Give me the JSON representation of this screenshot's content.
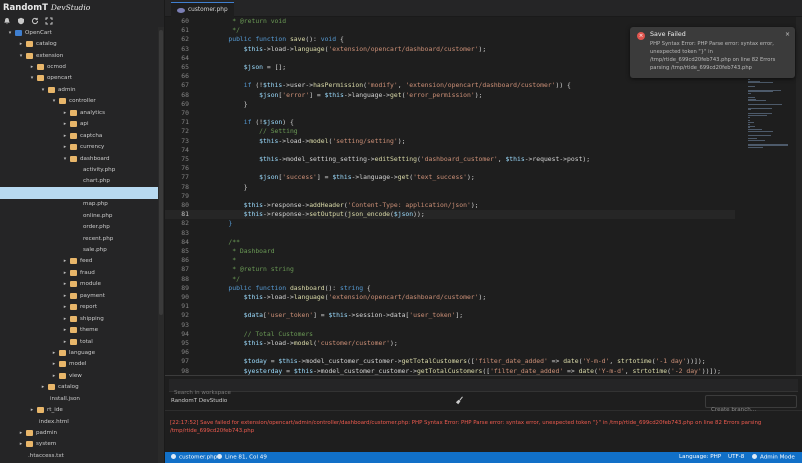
{
  "app": {
    "brand_main": "RandomT",
    "brand_sub": "DevStudio",
    "toolbar_icons": [
      "bell-icon",
      "shield-icon",
      "refresh-icon",
      "expand-icon"
    ]
  },
  "tree": [
    {
      "label": "OpenCart",
      "depth": 0,
      "kind": "root-open",
      "selected": false
    },
    {
      "label": "catalog",
      "depth": 1,
      "kind": "dir-closed",
      "selected": false
    },
    {
      "label": "extension",
      "depth": 1,
      "kind": "dir-open",
      "selected": false
    },
    {
      "label": "ocmod",
      "depth": 2,
      "kind": "dir-closed",
      "selected": false
    },
    {
      "label": "opencart",
      "depth": 2,
      "kind": "dir-open",
      "selected": false
    },
    {
      "label": "admin",
      "depth": 3,
      "kind": "dir-open",
      "selected": false
    },
    {
      "label": "controller",
      "depth": 4,
      "kind": "dir-open",
      "selected": false
    },
    {
      "label": "analytics",
      "depth": 5,
      "kind": "dir-closed",
      "selected": false
    },
    {
      "label": "api",
      "depth": 5,
      "kind": "dir-closed",
      "selected": false
    },
    {
      "label": "captcha",
      "depth": 5,
      "kind": "dir-closed",
      "selected": false
    },
    {
      "label": "currency",
      "depth": 5,
      "kind": "dir-closed",
      "selected": false
    },
    {
      "label": "dashboard",
      "depth": 5,
      "kind": "dir-open",
      "selected": false
    },
    {
      "label": "activity.php",
      "depth": 6,
      "kind": "file",
      "selected": false
    },
    {
      "label": "chart.php",
      "depth": 6,
      "kind": "file",
      "selected": false
    },
    {
      "label": "",
      "depth": 6,
      "kind": "file",
      "selected": true
    },
    {
      "label": "map.php",
      "depth": 6,
      "kind": "file",
      "selected": false
    },
    {
      "label": "online.php",
      "depth": 6,
      "kind": "file",
      "selected": false
    },
    {
      "label": "order.php",
      "depth": 6,
      "kind": "file",
      "selected": false
    },
    {
      "label": "recent.php",
      "depth": 6,
      "kind": "file",
      "selected": false
    },
    {
      "label": "sale.php",
      "depth": 6,
      "kind": "file",
      "selected": false
    },
    {
      "label": "feed",
      "depth": 5,
      "kind": "dir-closed",
      "selected": false
    },
    {
      "label": "fraud",
      "depth": 5,
      "kind": "dir-closed",
      "selected": false
    },
    {
      "label": "module",
      "depth": 5,
      "kind": "dir-closed",
      "selected": false
    },
    {
      "label": "payment",
      "depth": 5,
      "kind": "dir-closed",
      "selected": false
    },
    {
      "label": "report",
      "depth": 5,
      "kind": "dir-closed",
      "selected": false
    },
    {
      "label": "shipping",
      "depth": 5,
      "kind": "dir-closed",
      "selected": false
    },
    {
      "label": "theme",
      "depth": 5,
      "kind": "dir-closed",
      "selected": false
    },
    {
      "label": "total",
      "depth": 5,
      "kind": "dir-closed",
      "selected": false
    },
    {
      "label": "language",
      "depth": 4,
      "kind": "dir-closed",
      "selected": false
    },
    {
      "label": "model",
      "depth": 4,
      "kind": "dir-closed",
      "selected": false
    },
    {
      "label": "view",
      "depth": 4,
      "kind": "dir-closed",
      "selected": false
    },
    {
      "label": "catalog",
      "depth": 3,
      "kind": "dir-closed",
      "selected": false
    },
    {
      "label": "install.json",
      "depth": 3,
      "kind": "file",
      "selected": false
    },
    {
      "label": "rt_ide",
      "depth": 2,
      "kind": "dir-closed",
      "selected": false
    },
    {
      "label": "index.html",
      "depth": 2,
      "kind": "file",
      "selected": false
    },
    {
      "label": "padmin",
      "depth": 1,
      "kind": "dir-closed",
      "selected": false
    },
    {
      "label": "system",
      "depth": 1,
      "kind": "dir-closed",
      "selected": false
    },
    {
      "label": ".htaccess.txt",
      "depth": 1,
      "kind": "file",
      "selected": false
    }
  ],
  "editor": {
    "tab_label": "customer.php",
    "current_line": 81,
    "lines": [
      {
        "n": 60,
        "t": [
          [
            "c",
            "     * @return void"
          ]
        ]
      },
      {
        "n": 61,
        "t": [
          [
            "c",
            "     */"
          ]
        ]
      },
      {
        "n": 62,
        "t": [
          [
            "k",
            "    public function "
          ],
          [
            "f",
            "save"
          ],
          [
            "p",
            "(): "
          ],
          [
            "k",
            "void"
          ],
          [
            "p",
            " {"
          ]
        ]
      },
      {
        "n": 63,
        "t": [
          [
            "v",
            "        $this"
          ],
          [
            "p",
            "->load->"
          ],
          [
            "f",
            "language"
          ],
          [
            "p",
            "("
          ],
          [
            "s",
            "'extension/opencart/dashboard/customer'"
          ],
          [
            "p",
            ");"
          ]
        ]
      },
      {
        "n": 64,
        "t": []
      },
      {
        "n": 65,
        "t": [
          [
            "v",
            "        $json"
          ],
          [
            "p",
            " = [];"
          ]
        ]
      },
      {
        "n": 66,
        "t": []
      },
      {
        "n": 67,
        "t": [
          [
            "k",
            "        if"
          ],
          [
            "p",
            " (!"
          ],
          [
            "v",
            "$this"
          ],
          [
            "p",
            "->user->"
          ],
          [
            "f",
            "hasPermission"
          ],
          [
            "p",
            "("
          ],
          [
            "s",
            "'modify'"
          ],
          [
            "p",
            ", "
          ],
          [
            "s",
            "'extension/opencart/dashboard/customer'"
          ],
          [
            "p",
            ")) {"
          ]
        ]
      },
      {
        "n": 68,
        "t": [
          [
            "v",
            "            $json"
          ],
          [
            "p",
            "["
          ],
          [
            "s",
            "'error'"
          ],
          [
            "p",
            "] = "
          ],
          [
            "v",
            "$this"
          ],
          [
            "p",
            "->language->"
          ],
          [
            "f",
            "get"
          ],
          [
            "p",
            "("
          ],
          [
            "s",
            "'error_permission'"
          ],
          [
            "p",
            ");"
          ]
        ]
      },
      {
        "n": 69,
        "t": [
          [
            "p",
            "        }"
          ]
        ]
      },
      {
        "n": 70,
        "t": []
      },
      {
        "n": 71,
        "t": [
          [
            "k",
            "        if"
          ],
          [
            "p",
            " (!"
          ],
          [
            "v",
            "$json"
          ],
          [
            "p",
            ") {"
          ]
        ]
      },
      {
        "n": 72,
        "t": [
          [
            "c",
            "            // Setting"
          ]
        ]
      },
      {
        "n": 73,
        "t": [
          [
            "v",
            "            $this"
          ],
          [
            "p",
            "->load->"
          ],
          [
            "f",
            "model"
          ],
          [
            "p",
            "("
          ],
          [
            "s",
            "'setting/setting'"
          ],
          [
            "p",
            ");"
          ]
        ]
      },
      {
        "n": 74,
        "t": []
      },
      {
        "n": 75,
        "t": [
          [
            "v",
            "            $this"
          ],
          [
            "p",
            "->model_setting_setting->"
          ],
          [
            "f",
            "editSetting"
          ],
          [
            "p",
            "("
          ],
          [
            "s",
            "'dashboard_customer'"
          ],
          [
            "p",
            ", "
          ],
          [
            "v",
            "$this"
          ],
          [
            "p",
            "->request->post);"
          ]
        ]
      },
      {
        "n": 76,
        "t": []
      },
      {
        "n": 77,
        "t": [
          [
            "v",
            "            $json"
          ],
          [
            "p",
            "["
          ],
          [
            "s",
            "'success'"
          ],
          [
            "p",
            "] = "
          ],
          [
            "v",
            "$this"
          ],
          [
            "p",
            "->language->"
          ],
          [
            "f",
            "get"
          ],
          [
            "p",
            "("
          ],
          [
            "s",
            "'text_success'"
          ],
          [
            "p",
            ");"
          ]
        ]
      },
      {
        "n": 78,
        "t": [
          [
            "p",
            "        }"
          ]
        ]
      },
      {
        "n": 79,
        "t": []
      },
      {
        "n": 80,
        "t": [
          [
            "v",
            "        $this"
          ],
          [
            "p",
            "->response->"
          ],
          [
            "f",
            "addHeader"
          ],
          [
            "p",
            "("
          ],
          [
            "s",
            "'Content-Type: application/json'"
          ],
          [
            "p",
            ");"
          ]
        ]
      },
      {
        "n": 81,
        "t": [
          [
            "v",
            "        $this"
          ],
          [
            "p",
            "->response->"
          ],
          [
            "f",
            "setOutput"
          ],
          [
            "p",
            "("
          ],
          [
            "f",
            "json_encode"
          ],
          [
            "p",
            "("
          ],
          [
            "v",
            "$json"
          ],
          [
            "p",
            "));"
          ]
        ]
      },
      {
        "n": 82,
        "t": [
          [
            "k",
            "    }"
          ]
        ]
      },
      {
        "n": 83,
        "t": []
      },
      {
        "n": 84,
        "t": [
          [
            "c",
            "    /**"
          ]
        ]
      },
      {
        "n": 85,
        "t": [
          [
            "c",
            "     * Dashboard"
          ]
        ]
      },
      {
        "n": 86,
        "t": [
          [
            "c",
            "     *"
          ]
        ]
      },
      {
        "n": 87,
        "t": [
          [
            "c",
            "     * @return string"
          ]
        ]
      },
      {
        "n": 88,
        "t": [
          [
            "c",
            "     */"
          ]
        ]
      },
      {
        "n": 89,
        "t": [
          [
            "k",
            "    public function "
          ],
          [
            "f",
            "dashboard"
          ],
          [
            "p",
            "(): "
          ],
          [
            "k",
            "string"
          ],
          [
            "p",
            " {"
          ]
        ]
      },
      {
        "n": 90,
        "t": [
          [
            "v",
            "        $this"
          ],
          [
            "p",
            "->load->"
          ],
          [
            "f",
            "language"
          ],
          [
            "p",
            "("
          ],
          [
            "s",
            "'extension/opencart/dashboard/customer'"
          ],
          [
            "p",
            ");"
          ]
        ]
      },
      {
        "n": 91,
        "t": []
      },
      {
        "n": 92,
        "t": [
          [
            "v",
            "        $data"
          ],
          [
            "p",
            "["
          ],
          [
            "s",
            "'user_token'"
          ],
          [
            "p",
            "] = "
          ],
          [
            "v",
            "$this"
          ],
          [
            "p",
            "->session->data["
          ],
          [
            "s",
            "'user_token'"
          ],
          [
            "p",
            "];"
          ]
        ]
      },
      {
        "n": 93,
        "t": []
      },
      {
        "n": 94,
        "t": [
          [
            "c",
            "        // Total Customers"
          ]
        ]
      },
      {
        "n": 95,
        "t": [
          [
            "v",
            "        $this"
          ],
          [
            "p",
            "->load->"
          ],
          [
            "f",
            "model"
          ],
          [
            "p",
            "("
          ],
          [
            "s",
            "'customer/customer'"
          ],
          [
            "p",
            ");"
          ]
        ]
      },
      {
        "n": 96,
        "t": []
      },
      {
        "n": 97,
        "t": [
          [
            "v",
            "        $today"
          ],
          [
            "p",
            " = "
          ],
          [
            "v",
            "$this"
          ],
          [
            "p",
            "->model_customer_customer->"
          ],
          [
            "f",
            "getTotalCustomers"
          ],
          [
            "p",
            "(["
          ],
          [
            "s",
            "'filter_date_added'"
          ],
          [
            "p",
            " => "
          ],
          [
            "f",
            "date"
          ],
          [
            "p",
            "("
          ],
          [
            "s",
            "'Y-m-d'"
          ],
          [
            "p",
            ", "
          ],
          [
            "f",
            "strtotime"
          ],
          [
            "p",
            "("
          ],
          [
            "s",
            "'-1 day'"
          ],
          [
            "p",
            "))]);"
          ]
        ]
      },
      {
        "n": 98,
        "t": [
          [
            "v",
            "        $yesterday"
          ],
          [
            "p",
            " = "
          ],
          [
            "v",
            "$this"
          ],
          [
            "p",
            "->model_customer_customer->"
          ],
          [
            "f",
            "getTotalCustomers"
          ],
          [
            "p",
            "(["
          ],
          [
            "s",
            "'filter_date_added'"
          ],
          [
            "p",
            " => "
          ],
          [
            "f",
            "date"
          ],
          [
            "p",
            "("
          ],
          [
            "s",
            "'Y-m-d'"
          ],
          [
            "p",
            ", "
          ],
          [
            "f",
            "strtotime"
          ],
          [
            "p",
            "("
          ],
          [
            "s",
            "'-2 day'"
          ],
          [
            "p",
            "))]);"
          ]
        ]
      },
      {
        "n": 99,
        "t": [
          [
            "v",
            "        $difference"
          ],
          [
            "p",
            " = "
          ],
          [
            "v",
            "$today"
          ],
          [
            "p",
            " - "
          ],
          [
            "v",
            "$yesterday"
          ],
          [
            "p",
            ";"
          ]
        ]
      }
    ]
  },
  "toast": {
    "title": "Save Failed",
    "message": "PHP Syntax Error: PHP Parse error: syntax error, unexpected token \"}\" in /tmp/rtide_699cd20feb743.php on line 82 Errors parsing /tmp/rtide_699cd20feb743.php",
    "close": "×",
    "icon_glyph": "×"
  },
  "panel": {
    "search_placeholder": "Search in workspace",
    "terminal_title": "RandomT DevStudio",
    "branch_placeholder": "Create branch...",
    "output": "[22:17:52] Save failed for extension/opencart/admin/controller/dashboard/customer.php: PHP Syntax Error: PHP Parse error: syntax error, unexpected token \"}\" in /tmp/rtide_699cd20feb743.php on line 82 Errors parsing /tmp/rtide_699cd20feb743.php"
  },
  "status": {
    "file": "customer.php",
    "position": "Line 81, Col 49",
    "language": "Language: PHP",
    "encoding": "UTF-8",
    "mode": "Admin Mode"
  },
  "colors": {
    "accent": "#1170c8",
    "error": "#e0554e",
    "folder": "#e8b66a",
    "selection": "#b7d9f0"
  }
}
